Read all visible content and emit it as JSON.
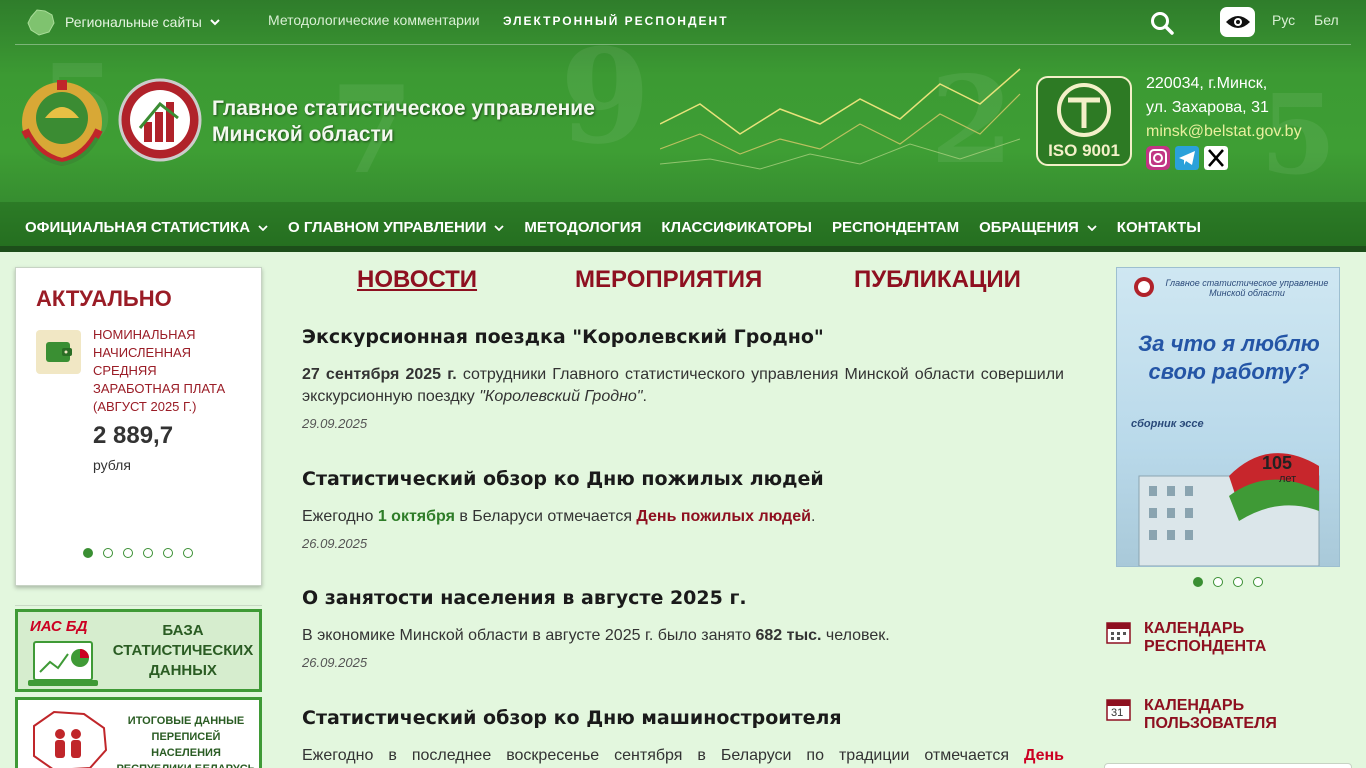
{
  "topbar": {
    "regional": "Региональные сайты",
    "methodology_comments": "Методологические комментарии",
    "e_respondent": "ЭЛЕКТРОННЫЙ РЕСПОНДЕНТ",
    "lang_ru": "Рус",
    "lang_be": "Бел"
  },
  "brand": {
    "title_line1": "Главное статистическое управление",
    "title_line2": "Минской области",
    "iso": "ISO 9001",
    "address_line1": "220034, г.Минск,",
    "address_line2": "ул. Захарова, 31",
    "email": "minsk@belstat.gov.by"
  },
  "nav": [
    {
      "label": "ОФИЦИАЛЬНАЯ СТАТИСТИКА",
      "dropdown": true
    },
    {
      "label": "О ГЛАВНОМ УПРАВЛЕНИИ",
      "dropdown": true
    },
    {
      "label": "МЕТОДОЛОГИЯ",
      "dropdown": false
    },
    {
      "label": "КЛАССИФИКАТОРЫ",
      "dropdown": false
    },
    {
      "label": "РЕСПОНДЕНТАМ",
      "dropdown": false
    },
    {
      "label": "ОБРАЩЕНИЯ",
      "dropdown": true
    },
    {
      "label": "КОНТАКТЫ",
      "dropdown": false
    }
  ],
  "actual": {
    "title": "АКТУАЛЬНО",
    "label": "Номинальная начисленная средняя заработная плата (август 2025 г.)",
    "value": "2 889,7",
    "unit": "рубля",
    "slides": 6,
    "active_slide": 0
  },
  "left_banners": {
    "ias_tag": "ИАС БД",
    "ias_text": "БАЗА СТАТИСТИЧЕСКИХ ДАННЫХ",
    "census_text": "ИТОГОВЫЕ ДАННЫЕ ПЕРЕПИСЕЙ НАСЕЛЕНИЯ РЕСПУБЛИКИ БЕЛАРУСЬ"
  },
  "tabs": {
    "news": "НОВОСТИ",
    "events": "МЕРОПРИЯТИЯ",
    "publications": "ПУБЛИКАЦИИ"
  },
  "news": [
    {
      "title": "Экскурсионная поездка \"Королевский Гродно\"",
      "t1": "27 сентября 2025 г.",
      "t2": " сотрудники Главного статистического управления Минской области совершили экскурсионную поездку ",
      "t3": "\"Королевский Гродно\"",
      "t4": ".",
      "date": "29.09.2025"
    },
    {
      "title": "Статистический обзор ко Дню пожилых людей",
      "t1": "Ежегодно ",
      "t2": "1 октября",
      "t3": " в Беларуси отмечается ",
      "t4": "День пожилых людей",
      "t5": ".",
      "date": "26.09.2025"
    },
    {
      "title": "О занятости населения в августе 2025 г.",
      "t1": "В экономике Минской области в августе 2025 г. было занято ",
      "t2": "682 тыс.",
      "t3": " человек.",
      "date": "26.09.2025"
    },
    {
      "title": "Статистический обзор ко Дню машиностроителя",
      "t1": "Ежегодно в последнее воскресенье сентября в Беларуси по традиции отмечается ",
      "t2": "День"
    }
  ],
  "book": {
    "header": "Главное статистическое управление Минской области",
    "title": "За что я люблю свою работу?",
    "subtitle": "сборник эссе",
    "number": "105",
    "years": "лет",
    "slides": 4,
    "active_slide": 0
  },
  "calendars": {
    "respondent_l1": "КАЛЕНДАРЬ",
    "respondent_l2": "РЕСПОНДЕНТА",
    "user_l1": "КАЛЕНДАРЬ",
    "user_l2": "ПОЛЬЗОВАТЕЛЯ",
    "user_day": "31"
  },
  "colors": {
    "header_green": "#3c9a33",
    "accent_red": "#8e1020",
    "page_bg": "#e3f7de"
  }
}
